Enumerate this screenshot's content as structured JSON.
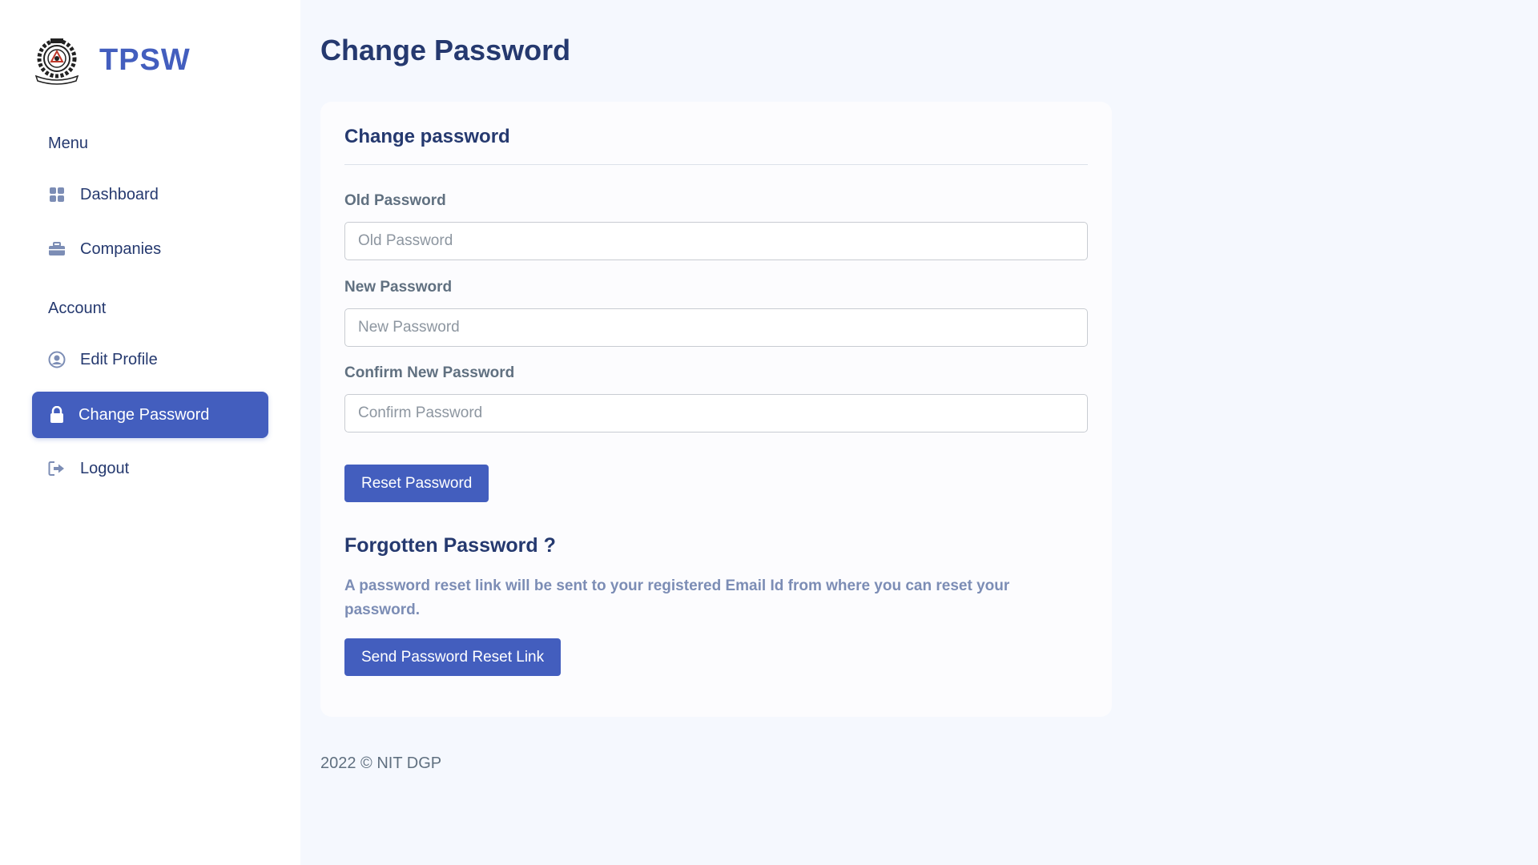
{
  "sidebar": {
    "brand": {
      "name": "TPSW",
      "logo_icon": "institute-emblem-icon"
    },
    "sections": [
      {
        "title": "Menu"
      },
      {
        "title": "Account"
      }
    ],
    "items": [
      {
        "label": "Dashboard",
        "icon": "grid-icon"
      },
      {
        "label": "Companies",
        "icon": "briefcase-icon"
      },
      {
        "label": "Edit Profile",
        "icon": "user-circle-icon"
      },
      {
        "label": "Change Password",
        "icon": "lock-icon",
        "active": true
      },
      {
        "label": "Logout",
        "icon": "logout-icon"
      }
    ]
  },
  "page": {
    "title": "Change Password"
  },
  "card": {
    "title": "Change password",
    "fields": [
      {
        "label": "Old Password",
        "placeholder": "Old Password",
        "value": ""
      },
      {
        "label": "New Password",
        "placeholder": "New Password",
        "value": ""
      },
      {
        "label": "Confirm New Password",
        "placeholder": "Confirm Password",
        "value": ""
      }
    ],
    "reset_button": "Reset Password",
    "forgot": {
      "title": "Forgotten Password ?",
      "text": "A password reset link will be sent to your registered Email Id from where you can reset your password.",
      "button": "Send Password Reset Link"
    }
  },
  "footer": {
    "text": "2022 © NIT DGP"
  },
  "colors": {
    "accent": "#435ebe",
    "heading": "#25396f",
    "background": "#f5f8fe"
  }
}
